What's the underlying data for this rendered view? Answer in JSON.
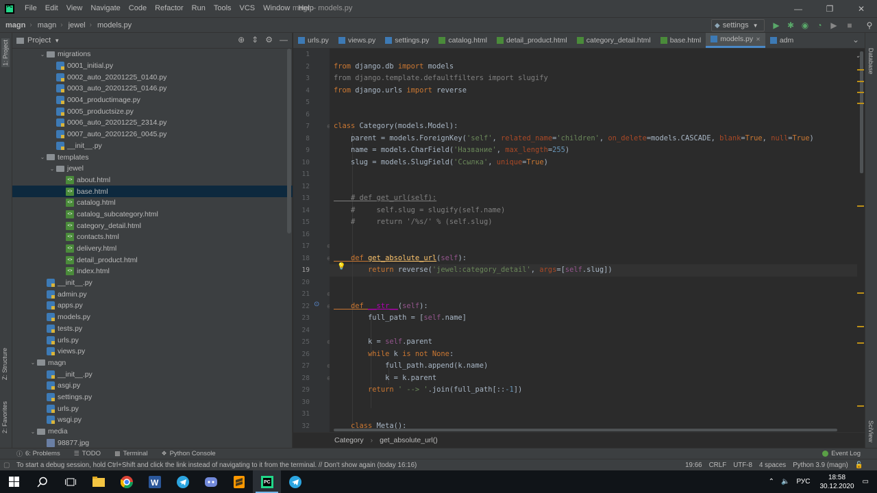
{
  "menu": [
    "File",
    "Edit",
    "View",
    "Navigate",
    "Code",
    "Refactor",
    "Run",
    "Tools",
    "VCS",
    "Window",
    "Help"
  ],
  "window_title": "magn - models.py",
  "breadcrumbs": [
    "magn",
    "magn",
    "jewel",
    "models.py"
  ],
  "run_config": "settings",
  "project_panel": {
    "title": "Project"
  },
  "tree": [
    {
      "label": "migrations",
      "depth": 3,
      "type": "folder",
      "open": true
    },
    {
      "label": "0001_initial.py",
      "depth": 4,
      "type": "py"
    },
    {
      "label": "0002_auto_20201225_0140.py",
      "depth": 4,
      "type": "py"
    },
    {
      "label": "0003_auto_20201225_0146.py",
      "depth": 4,
      "type": "py"
    },
    {
      "label": "0004_productimage.py",
      "depth": 4,
      "type": "py"
    },
    {
      "label": "0005_productsize.py",
      "depth": 4,
      "type": "py"
    },
    {
      "label": "0006_auto_20201225_2314.py",
      "depth": 4,
      "type": "py"
    },
    {
      "label": "0007_auto_20201226_0045.py",
      "depth": 4,
      "type": "py"
    },
    {
      "label": "__init__.py",
      "depth": 4,
      "type": "py"
    },
    {
      "label": "templates",
      "depth": 3,
      "type": "folder",
      "open": true
    },
    {
      "label": "jewel",
      "depth": 4,
      "type": "folder",
      "open": true
    },
    {
      "label": "about.html",
      "depth": 5,
      "type": "html"
    },
    {
      "label": "base.html",
      "depth": 5,
      "type": "html",
      "selected": true
    },
    {
      "label": "catalog.html",
      "depth": 5,
      "type": "html"
    },
    {
      "label": "catalog_subcategory.html",
      "depth": 5,
      "type": "html"
    },
    {
      "label": "category_detail.html",
      "depth": 5,
      "type": "html"
    },
    {
      "label": "contacts.html",
      "depth": 5,
      "type": "html"
    },
    {
      "label": "delivery.html",
      "depth": 5,
      "type": "html"
    },
    {
      "label": "detail_product.html",
      "depth": 5,
      "type": "html"
    },
    {
      "label": "index.html",
      "depth": 5,
      "type": "html"
    },
    {
      "label": "__init__.py",
      "depth": 3,
      "type": "py"
    },
    {
      "label": "admin.py",
      "depth": 3,
      "type": "py"
    },
    {
      "label": "apps.py",
      "depth": 3,
      "type": "py"
    },
    {
      "label": "models.py",
      "depth": 3,
      "type": "py"
    },
    {
      "label": "tests.py",
      "depth": 3,
      "type": "py"
    },
    {
      "label": "urls.py",
      "depth": 3,
      "type": "py"
    },
    {
      "label": "views.py",
      "depth": 3,
      "type": "py"
    },
    {
      "label": "magn",
      "depth": 2,
      "type": "folder",
      "open": true
    },
    {
      "label": "__init__.py",
      "depth": 3,
      "type": "py"
    },
    {
      "label": "asgi.py",
      "depth": 3,
      "type": "py"
    },
    {
      "label": "settings.py",
      "depth": 3,
      "type": "py"
    },
    {
      "label": "urls.py",
      "depth": 3,
      "type": "py"
    },
    {
      "label": "wsgi.py",
      "depth": 3,
      "type": "py"
    },
    {
      "label": "media",
      "depth": 2,
      "type": "folder",
      "open": true
    },
    {
      "label": "98877.jpg",
      "depth": 3,
      "type": "img"
    }
  ],
  "tabs": [
    {
      "label": "urls.py",
      "type": "py"
    },
    {
      "label": "views.py",
      "type": "py"
    },
    {
      "label": "settings.py",
      "type": "py"
    },
    {
      "label": "catalog.html",
      "type": "html"
    },
    {
      "label": "detail_product.html",
      "type": "html"
    },
    {
      "label": "category_detail.html",
      "type": "html"
    },
    {
      "label": "base.html",
      "type": "html"
    },
    {
      "label": "models.py",
      "type": "py",
      "active": true
    },
    {
      "label": "adm",
      "type": "py"
    }
  ],
  "inspections": {
    "warnings": "6",
    "weak_warnings": "11"
  },
  "current_line": 19,
  "code_lines": [
    [],
    [
      [
        "kw",
        "from "
      ],
      [
        "t",
        "django.db "
      ],
      [
        "kw",
        "import "
      ],
      [
        "t",
        "models"
      ]
    ],
    [
      [
        "cm",
        "from django.template.defaultfilters import slugify"
      ]
    ],
    [
      [
        "kw",
        "from "
      ],
      [
        "t",
        "django.urls "
      ],
      [
        "kw",
        "import "
      ],
      [
        "t",
        "reverse"
      ]
    ],
    [],
    [],
    [
      [
        "kw",
        "class "
      ],
      [
        "t",
        "Category(models.Model):"
      ]
    ],
    [
      [
        "t",
        "    parent = models.ForeignKey("
      ],
      [
        "str",
        "'self'"
      ],
      [
        "t",
        ", "
      ],
      [
        "param",
        "related_name"
      ],
      [
        "t",
        "="
      ],
      [
        "str",
        "'children'"
      ],
      [
        "t",
        ", "
      ],
      [
        "param",
        "on_delete"
      ],
      [
        "t",
        "=models.CASCADE, "
      ],
      [
        "param",
        "blank"
      ],
      [
        "t",
        "="
      ],
      [
        "kw",
        "True"
      ],
      [
        "t",
        ", "
      ],
      [
        "param",
        "null"
      ],
      [
        "t",
        "="
      ],
      [
        "kw",
        "True"
      ],
      [
        "t",
        ")"
      ]
    ],
    [
      [
        "t",
        "    name = models.CharField("
      ],
      [
        "str",
        "'Название'"
      ],
      [
        "t",
        ", "
      ],
      [
        "param",
        "max_length"
      ],
      [
        "t",
        "="
      ],
      [
        "num",
        "255"
      ],
      [
        "t",
        ")"
      ]
    ],
    [
      [
        "t",
        "    slug = models.SlugField("
      ],
      [
        "str",
        "'Ссылка'"
      ],
      [
        "t",
        ", "
      ],
      [
        "param",
        "unique"
      ],
      [
        "t",
        "="
      ],
      [
        "kw",
        "True"
      ],
      [
        "t",
        ")"
      ]
    ],
    [],
    [],
    [
      [
        "cm",
        "    # def get_url(self):"
      ]
    ],
    [
      [
        "cm",
        "    #     self.slug = slugify(self.name)"
      ]
    ],
    [
      [
        "cm",
        "    #     return '/%s/' % (self.slug)"
      ]
    ],
    [],
    [],
    [
      [
        "kw",
        "    def "
      ],
      [
        "fn",
        "get_absolute_url"
      ],
      [
        "t",
        "("
      ],
      [
        "selfk",
        "self"
      ],
      [
        "t",
        "):"
      ]
    ],
    [
      [
        "t",
        "        "
      ],
      [
        "kw",
        "return "
      ],
      [
        "t",
        "reverse("
      ],
      [
        "str",
        "'jewel:category_detail'"
      ],
      [
        "t",
        ", "
      ],
      [
        "param",
        "args"
      ],
      [
        "t",
        "=["
      ],
      [
        "selfk",
        "self"
      ],
      [
        "t",
        ".slug])"
      ]
    ],
    [],
    [],
    [
      [
        "kw",
        "    def "
      ],
      [
        "magic",
        "__str__"
      ],
      [
        "t",
        "("
      ],
      [
        "selfk",
        "self"
      ],
      [
        "t",
        "):"
      ]
    ],
    [
      [
        "t",
        "        full_path = ["
      ],
      [
        "selfk",
        "self"
      ],
      [
        "t",
        ".name]"
      ]
    ],
    [],
    [
      [
        "t",
        "        k = "
      ],
      [
        "selfk",
        "self"
      ],
      [
        "t",
        ".parent"
      ]
    ],
    [
      [
        "t",
        "        "
      ],
      [
        "kw",
        "while "
      ],
      [
        "t",
        "k "
      ],
      [
        "kw",
        "is not None"
      ],
      [
        "t",
        ":"
      ]
    ],
    [
      [
        "t",
        "            full_path.append(k.name)"
      ]
    ],
    [
      [
        "t",
        "            k = k.parent"
      ]
    ],
    [
      [
        "t",
        "        "
      ],
      [
        "kw",
        "return "
      ],
      [
        "str",
        "' --> '"
      ],
      [
        "t",
        ".join(full_path[::"
      ],
      [
        "num",
        "-1"
      ],
      [
        "t",
        "])"
      ]
    ],
    [],
    [],
    [
      [
        "kw",
        "    class "
      ],
      [
        "t",
        "Meta():"
      ]
    ]
  ],
  "editor_breadcrumb": [
    "Category",
    "get_absolute_url()"
  ],
  "bottom_tools": [
    {
      "label": "6: Problems",
      "icon": "problems-icon"
    },
    {
      "label": "TODO",
      "icon": "todo-icon"
    },
    {
      "label": "Terminal",
      "icon": "terminal-icon"
    },
    {
      "label": "Python Console",
      "icon": "python-console-icon"
    }
  ],
  "event_log": "Event Log",
  "status_message": "To start a debug session, hold Ctrl+Shift and click the link instead of navigating to it from the terminal. // Don't show again (today 16:16)",
  "status_right": [
    "19:66",
    "CRLF",
    "UTF-8",
    "4 spaces",
    "Python 3.9 (magn)"
  ],
  "left_strip": [
    "1: Project",
    "Z: Structure",
    "2: Favorites"
  ],
  "right_strip": [
    "Database",
    "SciView"
  ],
  "taskbar": {
    "lang": "РУС",
    "time": "18:58",
    "date": "30.12.2020"
  }
}
